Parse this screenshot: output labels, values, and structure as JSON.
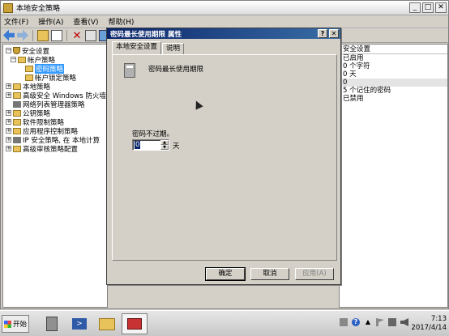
{
  "window": {
    "title": "本地安全策略"
  },
  "menu": [
    "文件(F)",
    "操作(A)",
    "查看(V)",
    "帮助(H)"
  ],
  "tree": {
    "items": [
      {
        "label": "安全设置"
      },
      {
        "label": "帐户策略"
      },
      {
        "label": "密码策略"
      },
      {
        "label": "帐户锁定策略"
      },
      {
        "label": "本地策略"
      },
      {
        "label": "高级安全 Windows 防火墙"
      },
      {
        "label": "网络列表管理器策略"
      },
      {
        "label": "公钥策略"
      },
      {
        "label": "软件限制策略"
      },
      {
        "label": "应用程序控制策略"
      },
      {
        "label": "IP 安全策略, 在 本地计算"
      },
      {
        "label": "高级审核策略配置"
      }
    ]
  },
  "list": {
    "header": "安全设置",
    "rows": [
      "已启用",
      "0 个字符",
      "0 天",
      "0",
      "5 个记住的密码",
      "已禁用"
    ]
  },
  "dialog": {
    "title": "密码最长使用期限 属性",
    "tabs": [
      "本地安全设置",
      "说明"
    ],
    "policy_name": "密码最长使用期限",
    "never_expire_label": "密码不过期。",
    "value": "0",
    "unit": "天",
    "ok": "确定",
    "cancel": "取消",
    "apply": "应用(A)"
  },
  "taskbar": {
    "start": "开始",
    "time": "7:13",
    "date": "2017/4/14"
  }
}
